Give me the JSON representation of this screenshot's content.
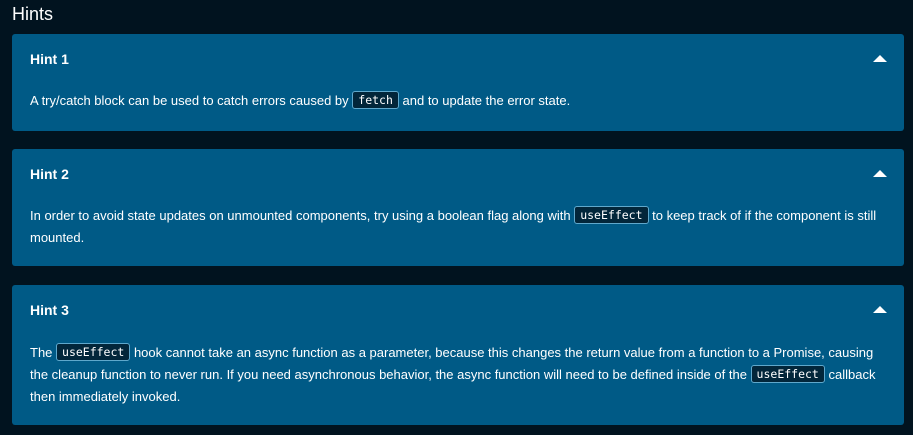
{
  "title": "Hints",
  "colors": {
    "background": "#01131f",
    "panel": "#005a86",
    "code_background": "#02263a",
    "code_border": "#5fa8cc",
    "text": "#ffffff"
  },
  "hints": [
    {
      "label": "Hint 1",
      "toggle_icon": "caret-up-icon",
      "body": {
        "t1": "A try/catch block can be used to catch errors caused by ",
        "c1": "fetch",
        "t2": " and to update the error state."
      }
    },
    {
      "label": "Hint 2",
      "toggle_icon": "caret-up-icon",
      "body": {
        "t1": "In order to avoid state updates on unmounted components, try using a boolean flag along with ",
        "c1": "useEffect",
        "t2": " to keep track of if the component is still mounted."
      }
    },
    {
      "label": "Hint 3",
      "toggle_icon": "caret-up-icon",
      "body": {
        "t1": "The ",
        "c1": "useEffect",
        "t2": " hook cannot take an async function as a parameter, because this changes the return value from a function to a Promise, causing the cleanup function to never run. If you need asynchronous behavior, the async function will need to be defined inside of the ",
        "c2": "useEffect",
        "t3": " callback then immediately invoked."
      }
    }
  ]
}
